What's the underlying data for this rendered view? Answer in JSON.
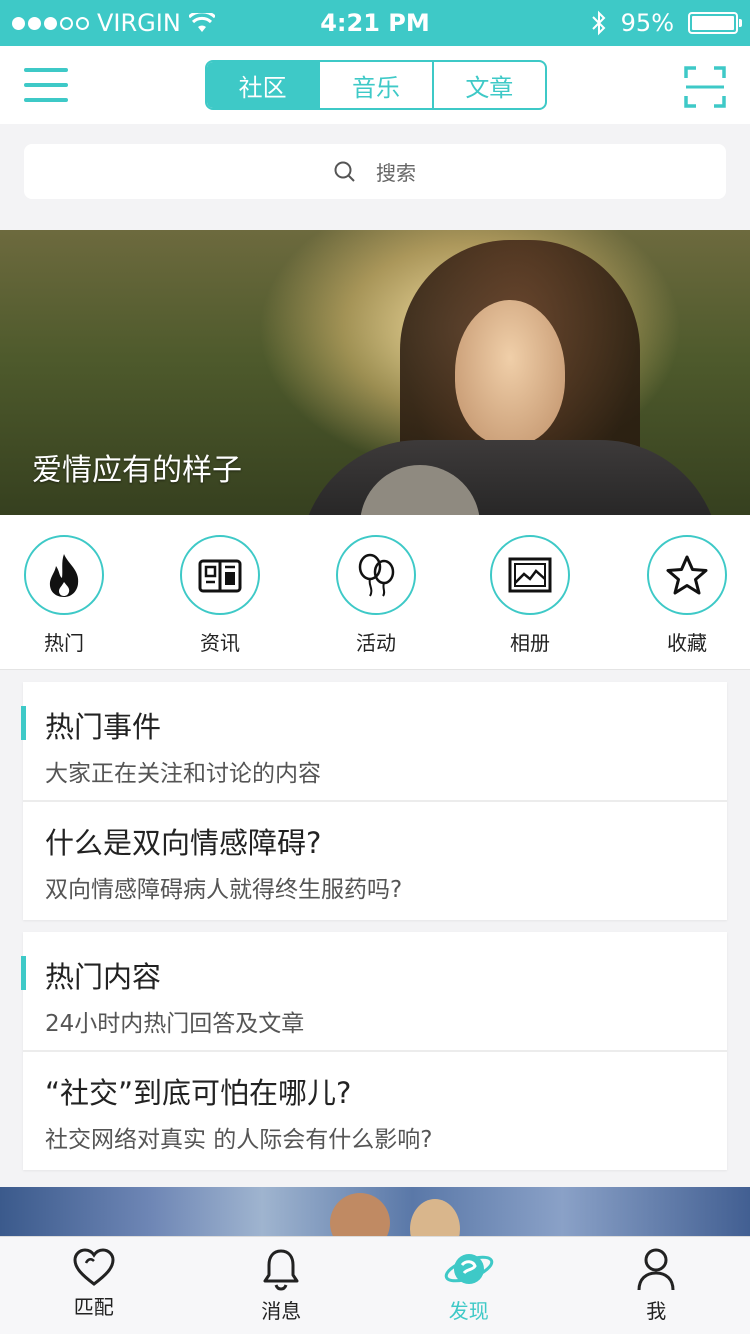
{
  "status_bar": {
    "carrier": "VIRGIN",
    "time": "4:21 PM",
    "battery": "95%",
    "signal_bars_filled": 3,
    "signal_bars_total": 5
  },
  "nav": {
    "tabs": [
      "社区",
      "音乐",
      "文章"
    ],
    "active_tab": "社区",
    "menu_icon": "hamburger-menu-icon",
    "scan_icon": "scan-icon"
  },
  "search": {
    "placeholder": "搜索",
    "icon": "search-icon"
  },
  "banner": {
    "caption": "爱情应有的样子"
  },
  "categories": [
    {
      "label": "热门",
      "icon": "flame-icon"
    },
    {
      "label": "资讯",
      "icon": "news-icon"
    },
    {
      "label": "活动",
      "icon": "balloons-icon"
    },
    {
      "label": "相册",
      "icon": "album-icon"
    },
    {
      "label": "收藏",
      "icon": "star-icon"
    }
  ],
  "sections": [
    {
      "title": "热门事件",
      "subtitle": "大家正在关注和讨论的内容",
      "item": {
        "title": "什么是双向情感障碍?",
        "desc": "双向情感障碍病人就得终生服药吗?"
      }
    },
    {
      "title": "热门内容",
      "subtitle": "24小时内热门回答及文章",
      "item": {
        "title": "“社交”到底可怕在哪儿?",
        "desc": "社交网络对真实 的人际会有什么影响?"
      }
    }
  ],
  "tab_bar": [
    {
      "label": "匹配",
      "icon": "heart-icon"
    },
    {
      "label": "消息",
      "icon": "bell-icon"
    },
    {
      "label": "发现",
      "icon": "planet-icon",
      "active": true
    },
    {
      "label": "我",
      "icon": "person-icon"
    }
  ],
  "colors": {
    "accent": "#3ec9c7",
    "background": "#f3f3f5"
  }
}
